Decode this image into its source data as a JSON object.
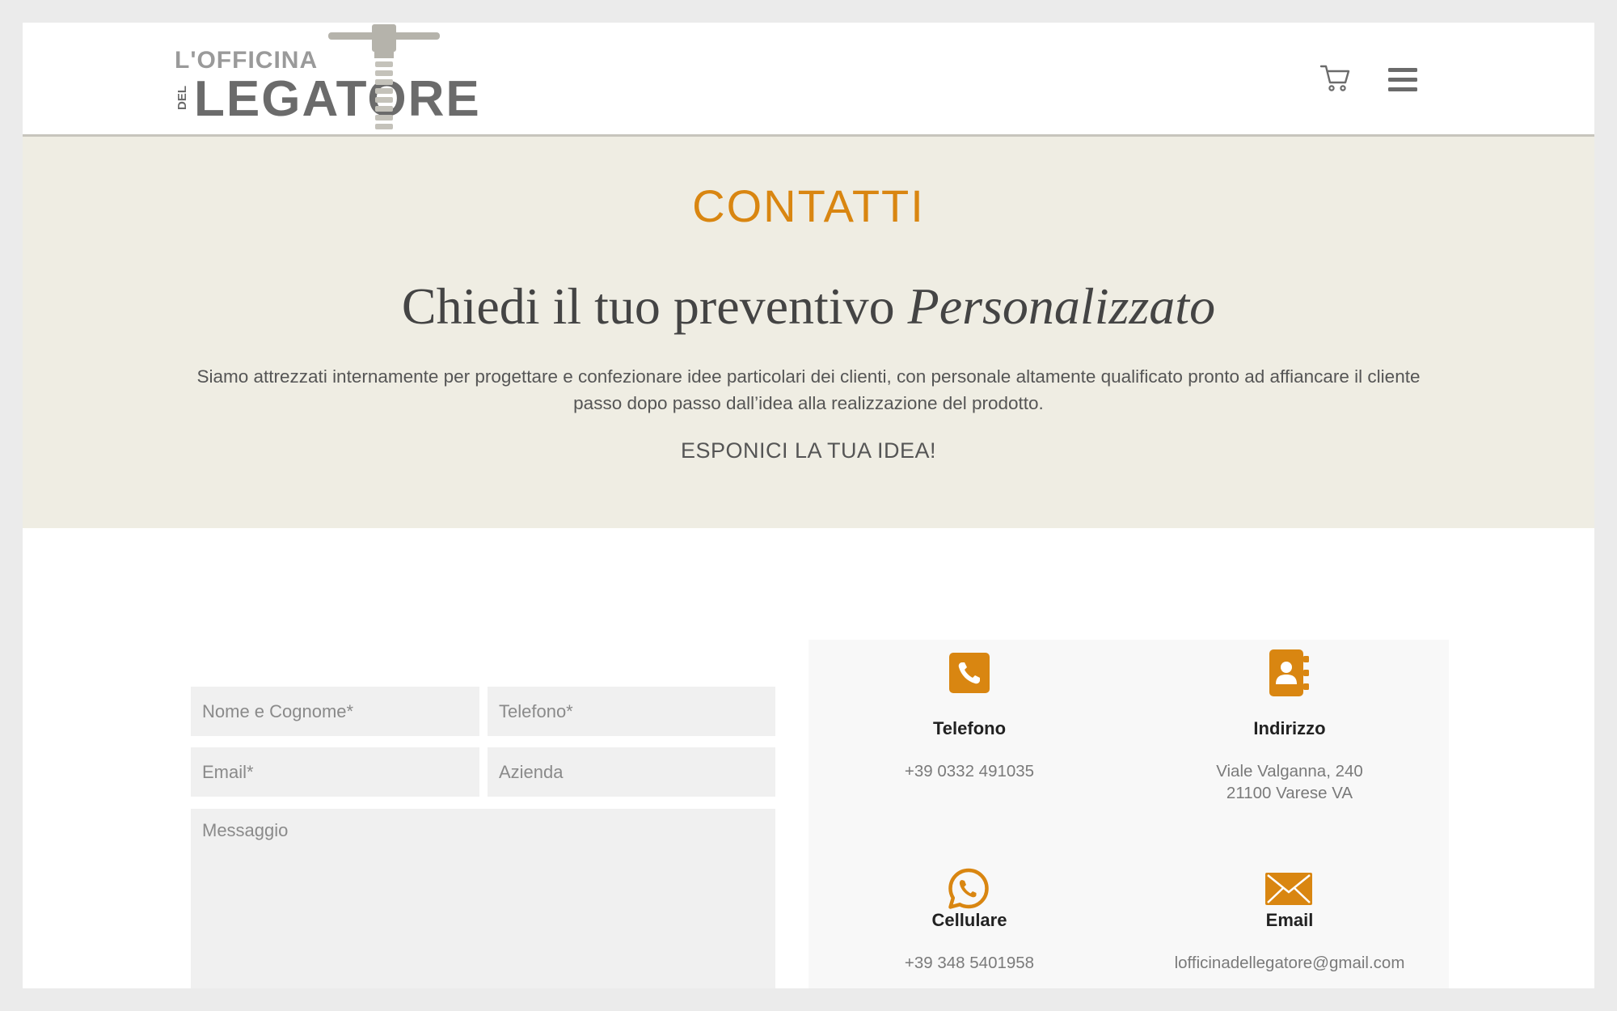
{
  "header": {
    "logo_top": "L'OFFICINA",
    "logo_del": "DEL",
    "logo_main": "LEGATORE"
  },
  "icons": {
    "cart": "shopping-cart-icon",
    "menu": "hamburger-menu-icon",
    "phone": "phone-icon",
    "address": "address-book-icon",
    "whatsapp": "whatsapp-icon",
    "email": "envelope-icon"
  },
  "colors": {
    "accent": "#d98611",
    "hero_bg": "#efede3",
    "text_dark": "#444444"
  },
  "hero": {
    "title": "CONTATTI",
    "heading_plain": "Chiedi il tuo preventivo ",
    "heading_italic": "Personalizzato",
    "description": "Siamo attrezzati internamente per progettare e confezionare idee particolari dei clienti, con personale altamente qualificato pronto ad affiancare il cliente passo dopo passo dall’idea alla realizzazione del prodotto.",
    "cta": "ESPONICI LA TUA IDEA!"
  },
  "form": {
    "name_placeholder": "Nome e Cognome*",
    "phone_placeholder": "Telefono*",
    "email_placeholder": "Email*",
    "company_placeholder": "Azienda",
    "message_placeholder": "Messaggio"
  },
  "contact": {
    "phone": {
      "label": "Telefono",
      "value": "+39 0332 491035"
    },
    "address": {
      "label": "Indirizzo",
      "line1": "Viale Valganna, 240",
      "line2": "21100 Varese VA"
    },
    "mobile": {
      "label": "Cellulare",
      "value": "+39 348 5401958"
    },
    "email": {
      "label": "Email",
      "value": "lofficinadellegatore@gmail.com"
    }
  }
}
